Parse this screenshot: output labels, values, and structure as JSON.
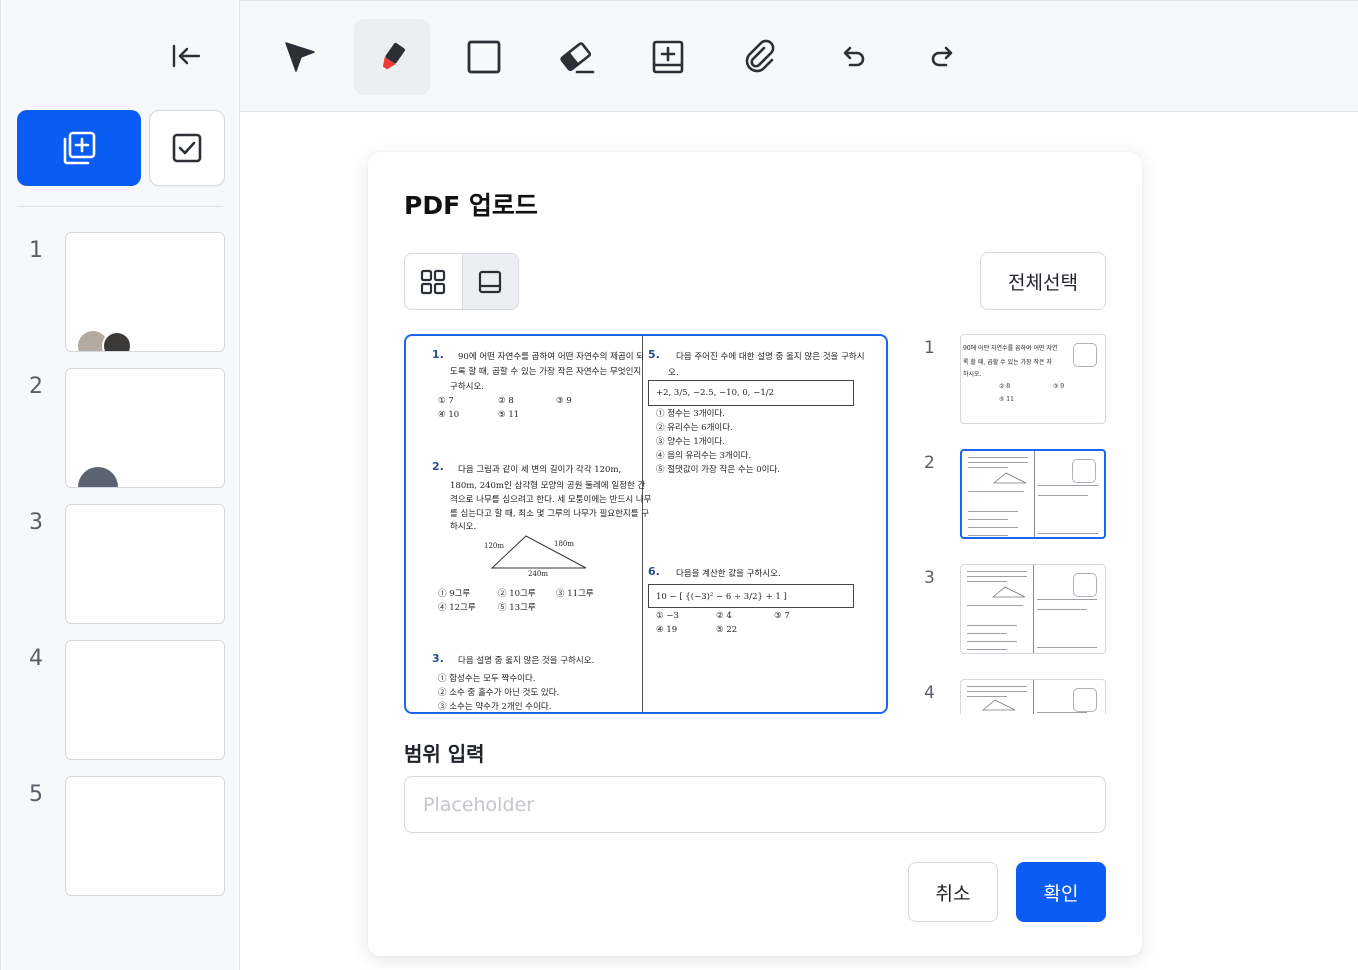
{
  "sidebar": {
    "pages": [
      {
        "number": "1"
      },
      {
        "number": "2"
      },
      {
        "number": "3"
      },
      {
        "number": "4"
      },
      {
        "number": "5"
      }
    ]
  },
  "toolbar": {
    "tools": [
      "pointer-tool",
      "pen-tool",
      "rectangle-tool",
      "eraser-tool",
      "add-box-tool",
      "attachment-tool",
      "undo",
      "redo"
    ],
    "active_tool": "pen-tool"
  },
  "modal": {
    "title": "PDF 업로드",
    "select_all_label": "전체선택",
    "range_label": "범위 입력",
    "range_placeholder": "Placeholder",
    "range_value": "",
    "cancel_label": "취소",
    "confirm_label": "확인",
    "view_mode": "single",
    "accent_color": "#0a5cf5"
  },
  "thumbnails": [
    {
      "number": "1",
      "selected": false
    },
    {
      "number": "2",
      "selected": true
    },
    {
      "number": "3",
      "selected": false
    },
    {
      "number": "4",
      "selected": false
    }
  ],
  "preview": {
    "q1": {
      "num": "1.",
      "text": [
        "90에 어떤 자연수를 곱하여 어떤 자연수의 제곱이 되",
        "도록 할 때, 곱할 수 있는 가장 작은 자연수는 무엇인지",
        "구하시오."
      ],
      "choices": [
        "① 7",
        "② 8",
        "③ 9",
        "④ 10",
        "⑤ 11"
      ]
    },
    "q2": {
      "num": "2.",
      "text": [
        "다음 그림과 같이 세 변의 길이가 각각 120m,",
        "180m, 240m인 삼각형 모양의 공원 둘레에 일정한 간",
        "격으로 나무를 심으려고 한다. 세 모퉁이에는 반드시 나무",
        "를 심는다고 할 때, 최소 몇 그루의 나무가 필요한지를 구",
        "하시오."
      ],
      "fig": [
        "120m",
        "180m",
        "240m"
      ],
      "choices": [
        "① 9그루",
        "② 10그루",
        "③ 11그루",
        "④ 12그루",
        "⑤ 13그루"
      ]
    },
    "q3": {
      "num": "3.",
      "text": [
        "다음 설명 중 옳지 않은 것을 구하시오."
      ],
      "choices": [
        "① 합성수는 모두 짝수이다.",
        "② 소수 중 홀수가 아닌 것도 있다.",
        "③ 소수는 약수가 2개인 수이다."
      ]
    },
    "q5": {
      "num": "5.",
      "text": [
        "다음 주어진 수에 대한 설명 중 옳지 않은 것을 구하시",
        "오."
      ],
      "box": "+2,   3/5,   −2.5,   −10,   0,   −1/2",
      "choices": [
        "① 정수는 3개이다.",
        "② 유리수는 6개이다.",
        "③ 양수는 1개이다.",
        "④ 음의 유리수는 3개이다.",
        "⑤ 절댓값이 가장 작은 수는 0이다."
      ]
    },
    "q6": {
      "num": "6.",
      "text": [
        "다음을 계산한 값을 구하시오."
      ],
      "box": "10 − [ {(−3)² − 6 ÷ 3/2} + 1 ]",
      "choices": [
        "① −3",
        "② 4",
        "③ 7",
        "④ 19",
        "⑤ 22"
      ]
    }
  },
  "thumb1_text": [
    "90에 어떤 자연수를 곱하여 어떤 자연",
    "록 할 때, 곱할 수 있는 가장 작은 자",
    "하시오.",
    "② 8",
    "③ 9",
    "⑤ 11"
  ]
}
